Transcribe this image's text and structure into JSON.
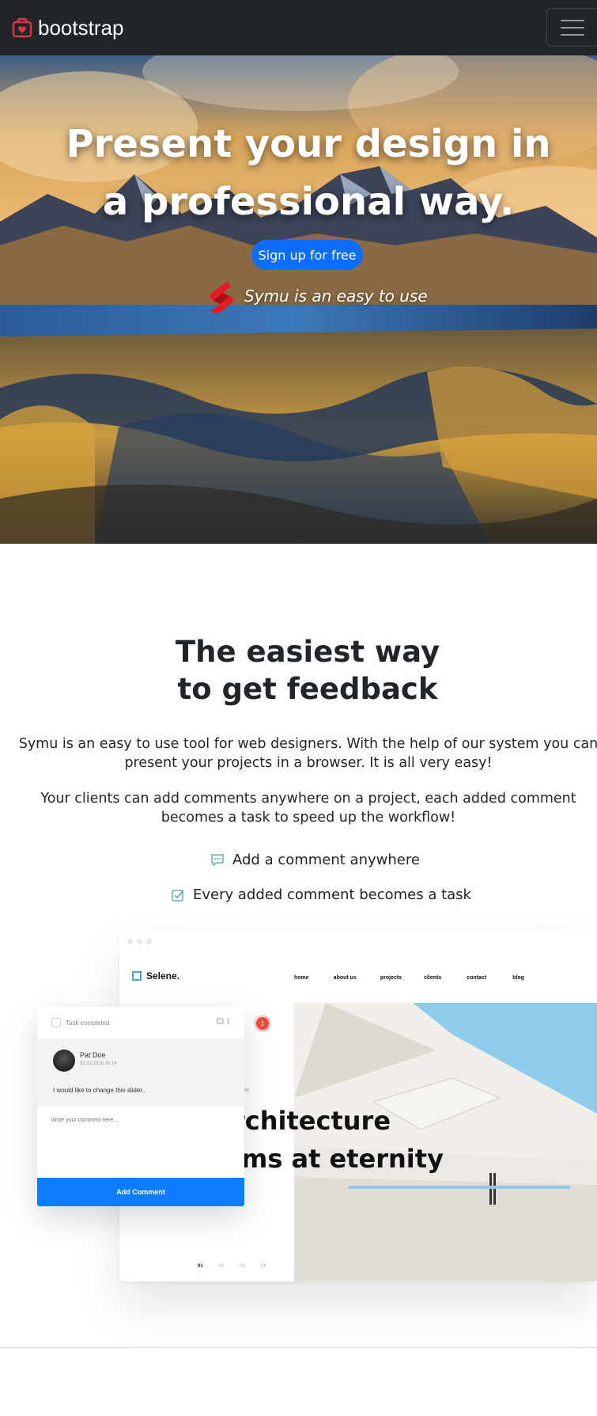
{
  "navbar": {
    "brand": "bootstrap",
    "brand_icon": "heart-box-icon",
    "toggler_icon": "hamburger-icon",
    "accent": "#dc3545"
  },
  "hero": {
    "title": "Present your design in a professional way.",
    "cta_label": "Sign up for free",
    "tagline": "Symu is an easy to use",
    "button_color": "#0d6efd"
  },
  "features": {
    "title_line1": "The easiest way",
    "title_line2": "to get feedback",
    "paragraph1": "Symu is an easy to use tool for web designers. With the help of our system you can present your projects in a browser. It is all very easy!",
    "paragraph2": "Your clients can add comments anywhere on a project, each added comment becomes a task to speed up the workflow!",
    "items": [
      {
        "icon": "chat-icon",
        "label": "Add a comment anywhere"
      },
      {
        "icon": "checkbox-icon",
        "label": "Every added comment becomes a task"
      }
    ]
  },
  "mockup": {
    "brand": "Selene.",
    "nav": [
      "home",
      "about us",
      "projects",
      "clients",
      "contact",
      "blog"
    ],
    "headline_line1": "Architecture",
    "headline_line2": "aims at eternity",
    "headline_visible_line1": "rchitecture",
    "headline_visible_line2": "ims at eternity",
    "doe_label": "Doe",
    "pin_count": "1",
    "slider": [
      "01",
      "02",
      "03",
      "04"
    ],
    "comment_card": {
      "task_label": "Task completed",
      "comment_count": "1",
      "author": "Pat Doe",
      "date": "31.12.2016 16:14",
      "comment": "I would like to change this slider..",
      "placeholder": "Write your comment here...",
      "button": "Add Comment"
    }
  }
}
